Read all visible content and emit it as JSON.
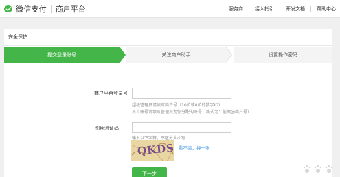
{
  "header": {
    "logo_text": "微信支付",
    "logo_sub": "商户平台",
    "nav": [
      {
        "label": "服务商"
      },
      {
        "label": "接入指引"
      },
      {
        "label": "开发文档"
      },
      {
        "label": "帮助中心"
      }
    ]
  },
  "panel": {
    "title": "安全保护"
  },
  "steps": [
    {
      "label": "提交登录账号",
      "state": "active"
    },
    {
      "label": "关注商户助手",
      "state": "pending"
    },
    {
      "label": "设置操作密码",
      "state": "pending"
    }
  ],
  "form": {
    "account_label": "商户平台登录号",
    "account_value": "",
    "account_hint_1": "超级管理员请填写商户号（10位或8位的数字ID）",
    "account_hint_2": "员工账号请填写管理员为你分配的账号（格式为：前缀@商户号）",
    "captcha_label": "图片验证码",
    "captcha_value": "",
    "captcha_hint": "输入以下字符，不区分大小写",
    "captcha_text": "QKDS",
    "refresh_link": "看不清，换一张",
    "next_button": "下一步"
  },
  "colors": {
    "brand_green": "#44b549",
    "link_blue": "#459ae9"
  }
}
